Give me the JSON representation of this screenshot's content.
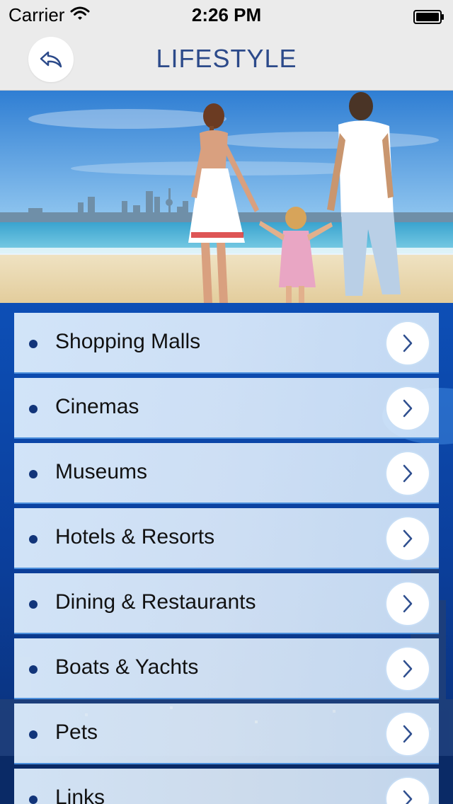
{
  "status_bar": {
    "carrier": "Carrier",
    "time": "2:26 PM",
    "wifi_icon": "wifi-icon",
    "battery_icon": "battery-icon"
  },
  "nav": {
    "title": "LIFESTYLE",
    "back_icon": "reply-arrow-icon"
  },
  "hero": {
    "image": "family-on-beach-with-city-skyline-photo"
  },
  "menu": {
    "items": [
      {
        "label": "Shopping Malls",
        "icon": "chevron-right-icon"
      },
      {
        "label": "Cinemas",
        "icon": "chevron-right-icon"
      },
      {
        "label": "Museums",
        "icon": "chevron-right-icon"
      },
      {
        "label": "Hotels & Resorts",
        "icon": "chevron-right-icon"
      },
      {
        "label": "Dining & Restaurants",
        "icon": "chevron-right-icon"
      },
      {
        "label": "Boats & Yachts",
        "icon": "chevron-right-icon"
      },
      {
        "label": "Pets",
        "icon": "chevron-right-icon"
      },
      {
        "label": "Links",
        "icon": "chevron-right-icon"
      }
    ]
  },
  "colors": {
    "nav_background": "#ebebeb",
    "title": "#2c4a8a",
    "bullet": "#12357a",
    "list_background": "#0b3f9c",
    "chevron": "#2f4f8f"
  }
}
